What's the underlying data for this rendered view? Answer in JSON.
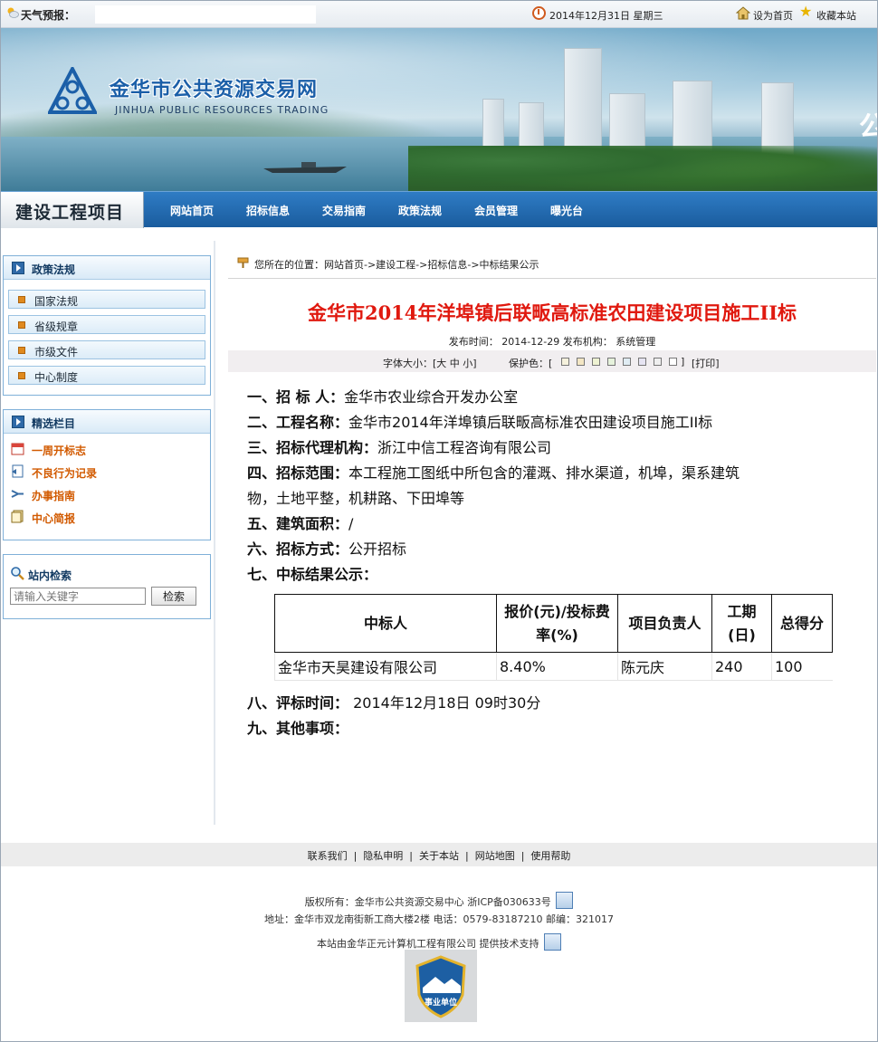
{
  "topbar": {
    "weather_label": "天气预报：",
    "date": "2014年12月31日  星期三",
    "set_home": "设为首页",
    "favorite": "收藏本站"
  },
  "banner": {
    "logo_cn": "金华市公共资源交易网",
    "logo_en": "JINHUA PUBLIC RESOURCES TRADING",
    "edge_glyph": "公"
  },
  "nav": {
    "section": "建设工程项目",
    "items": [
      "网站首页",
      "招标信息",
      "交易指南",
      "政策法规",
      "会员管理",
      "曝光台"
    ]
  },
  "sidebar": {
    "policy": {
      "title": "政策法规",
      "items": [
        "国家法规",
        "省级规章",
        "市级文件",
        "中心制度"
      ]
    },
    "picks": {
      "title": "精选栏目",
      "items": [
        {
          "label": "一周开标志",
          "icon": "calendar-icon"
        },
        {
          "label": "不良行为记录",
          "icon": "record-icon"
        },
        {
          "label": "办事指南",
          "icon": "arrow-icon"
        },
        {
          "label": "中心简报",
          "icon": "newsletter-icon"
        }
      ]
    },
    "search": {
      "title": "站内检索",
      "placeholder": "请输入关键字",
      "button": "检索"
    }
  },
  "breadcrumb": "您所在的位置：网站首页->建设工程->招标信息->中标结果公示",
  "article": {
    "title": "金华市2014年洋埠镇后联畈高标准农田建设项目施工II标",
    "meta": "发布时间： 2014-12-29  发布机构： 系统管理",
    "font_size_label": "字体大小：[大 中 小]",
    "protect_label": "保护色：[",
    "protect_close": "]",
    "print_label": "[打印]",
    "protect_colors": [
      "#f5f1dc",
      "#f3e6c4",
      "#eef2d2",
      "#e6f2dc",
      "#e0ecf3",
      "#e6e4f2",
      "#efefef",
      "#ffffff"
    ],
    "sections": [
      {
        "label": "一、招 标 人：",
        "value": "金华市农业综合开发办公室"
      },
      {
        "label": "二、工程名称：",
        "value": "金华市2014年洋埠镇后联畈高标准农田建设项目施工II标"
      },
      {
        "label": "三、招标代理机构：",
        "value": "浙江中信工程咨询有限公司"
      },
      {
        "label": "四、招标范围：",
        "value": "本工程施工图纸中所包含的灌溉、排水渠道，机埠，渠系建筑",
        "continuation": "物，土地平整，机耕路、下田埠等"
      },
      {
        "label": "五、建筑面积：",
        "value": "/"
      },
      {
        "label": "六、招标方式：",
        "value": "公开招标"
      },
      {
        "label": "七、中标结果公示：",
        "value": ""
      }
    ],
    "table": {
      "headers": [
        "中标人",
        "报价(元)/投标费率(%)",
        "项目负责人",
        "工期(日)",
        "总得分"
      ],
      "rows": [
        [
          "金华市天昊建设有限公司",
          "8.40%",
          "陈元庆",
          "240",
          "100"
        ]
      ]
    },
    "tail_sections": [
      {
        "label": "八、评标时间：",
        "value": " 2014年12月18日 09时30分"
      },
      {
        "label": "九、其他事项：",
        "value": ""
      }
    ]
  },
  "footer": {
    "links": [
      "联系我们",
      "隐私申明",
      "关于本站",
      "网站地图",
      "使用帮助"
    ],
    "copyright": "版权所有：金华市公共资源交易中心 浙ICP备030633号",
    "address": "地址：金华市双龙南街新工商大楼2楼 电话：0579-83187210 邮编：321017",
    "support": "本站由金华正元计算机工程有限公司 提供技术支持",
    "badge": "事业单位"
  }
}
